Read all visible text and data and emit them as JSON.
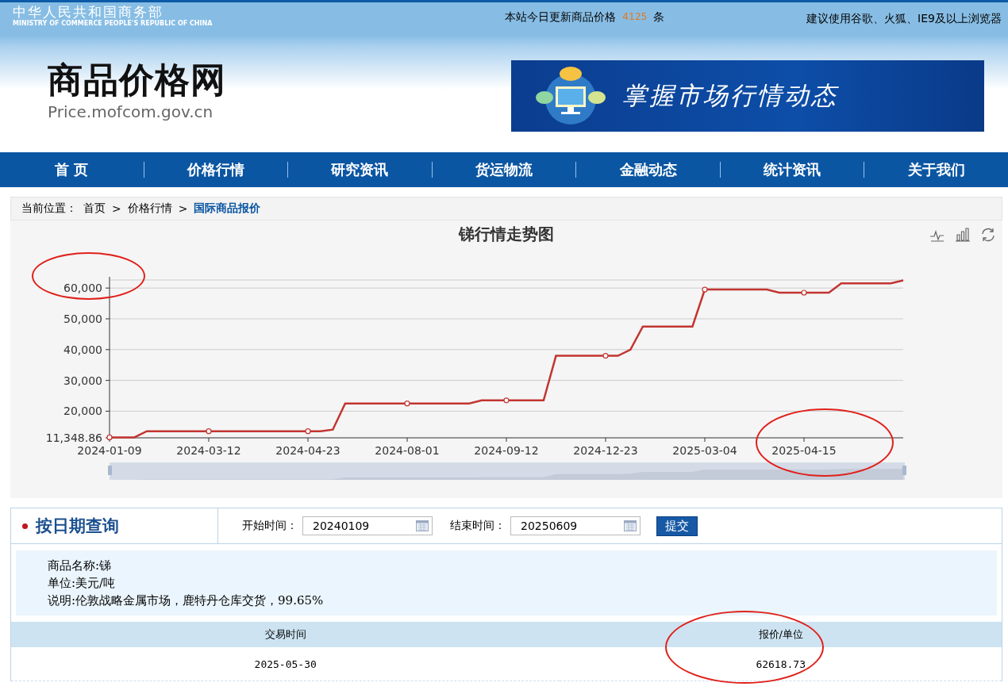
{
  "header": {
    "ministry_name": "中华人民共和国商务部",
    "ministry_name_en": "MINISTRY OF COMMERCE PEOPLE'S REPUBLIC OF CHINA",
    "update_prefix": "本站今日更新商品价格",
    "update_count": "4125",
    "update_suffix": "条",
    "browser_tip": "建议使用谷歌、火狐、IE9及以上浏览器",
    "site_name": "商品价格网",
    "site_url": "Price.mofcom.gov.cn",
    "banner_text": "掌握市场行情动态"
  },
  "nav": [
    "首 页",
    "价格行情",
    "研究资讯",
    "货运物流",
    "金融动态",
    "统计资讯",
    "关于我们"
  ],
  "breadcrumb": {
    "label": "当前位置：",
    "items": [
      {
        "text": "首页",
        "current": false
      },
      {
        "text": "价格行情",
        "current": false
      },
      {
        "text": "国际商品报价",
        "current": true
      }
    ],
    "separator": ">"
  },
  "chart": {
    "chart_data": {
      "type": "line",
      "title": "锑行情走势图",
      "categories": [
        "2024-01-09",
        null,
        null,
        null,
        null,
        null,
        null,
        null,
        "2024-03-12",
        null,
        null,
        null,
        null,
        null,
        null,
        null,
        "2024-04-23",
        null,
        null,
        null,
        null,
        null,
        null,
        null,
        "2024-08-01",
        null,
        null,
        null,
        null,
        null,
        null,
        null,
        "2024-09-12",
        null,
        null,
        null,
        null,
        null,
        null,
        null,
        "2024-12-23",
        null,
        null,
        null,
        null,
        null,
        null,
        null,
        "2025-03-04",
        null,
        null,
        null,
        null,
        null,
        null,
        null,
        "2025-04-15",
        null,
        null,
        null,
        null,
        null,
        null,
        null,
        null
      ],
      "series": [
        {
          "color": "#c23531",
          "values": [
            11500,
            11500,
            11500,
            13500,
            13500,
            13500,
            13500,
            13500,
            13500,
            13500,
            13500,
            13500,
            13500,
            13500,
            13500,
            13500,
            13500,
            13500,
            14000,
            22500,
            22500,
            22500,
            22500,
            22500,
            22500,
            22500,
            22500,
            22500,
            22500,
            22500,
            23500,
            23500,
            23500,
            23500,
            23500,
            23500,
            38000,
            38000,
            38000,
            38000,
            38000,
            38000,
            40000,
            47500,
            47500,
            47500,
            47500,
            47500,
            59500,
            59500,
            59500,
            59500,
            59500,
            59500,
            58500,
            58500,
            58500,
            58500,
            58500,
            61500,
            61500,
            61500,
            61500,
            61500,
            62500
          ]
        }
      ],
      "ylim": [
        11348.86,
        62618.73
      ],
      "grid": true,
      "yticks": [
        {
          "value": 11348.86,
          "label": "11,348.86"
        },
        {
          "value": 20000,
          "label": "20,000"
        },
        {
          "value": 30000,
          "label": "30,000"
        },
        {
          "value": 40000,
          "label": "40,000"
        },
        {
          "value": 50000,
          "label": "50,000"
        },
        {
          "value": 60000,
          "label": "60,000"
        }
      ]
    }
  },
  "query": {
    "title": "按日期查询",
    "start_label": "开始时间：",
    "start_value": "20240109",
    "end_label": "结束时间：",
    "end_value": "20250609",
    "submit": "提交"
  },
  "info": [
    "商品名称:锑",
    "单位:美元/吨",
    "说明:伦敦战略金属市场，鹿特丹仓库交货，99.65%"
  ],
  "table": {
    "columns": [
      "交易时间",
      "报价/单位"
    ],
    "rows": [
      [
        "2025-05-30",
        "62618.73"
      ]
    ]
  }
}
